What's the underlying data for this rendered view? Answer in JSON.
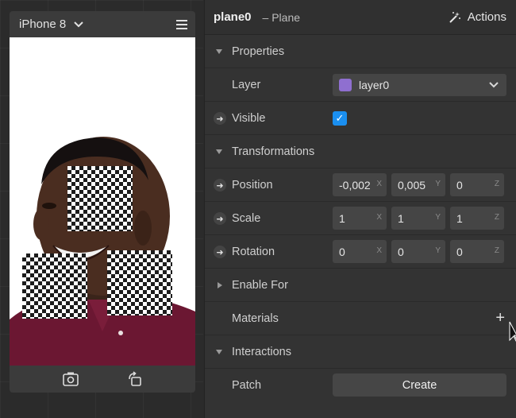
{
  "device": {
    "name": "iPhone 8",
    "chevron_icon": "chevron-down-icon",
    "menu_icon": "hamburger-menu-icon",
    "bottom_icons": [
      "flip-camera-icon",
      "rotate-device-icon"
    ]
  },
  "inspector": {
    "object_name": "plane0",
    "object_type": "– Plane",
    "actions_label": "Actions",
    "actions_icon": "magic-wand-icon"
  },
  "properties": {
    "header": "Properties",
    "layer_label": "Layer",
    "layer_value": "layer0",
    "layer_color": "#8f6fd0",
    "visible_label": "Visible",
    "visible_checked": true
  },
  "transformations": {
    "header": "Transformations",
    "position": {
      "label": "Position",
      "x": "-0,002",
      "y": "0,005",
      "z": "0"
    },
    "scale": {
      "label": "Scale",
      "x": "1",
      "y": "1",
      "z": "1"
    },
    "rotation": {
      "label": "Rotation",
      "x": "0",
      "y": "0",
      "z": "0"
    },
    "axes": {
      "x": "X",
      "y": "Y",
      "z": "Z"
    }
  },
  "enable_for": {
    "header": "Enable For"
  },
  "materials": {
    "label": "Materials",
    "add_symbol": "+"
  },
  "interactions": {
    "header": "Interactions",
    "patch_label": "Patch",
    "create_label": "Create"
  },
  "colors": {
    "accent": "#1a8ff0",
    "panel": "#333333",
    "field": "#454545"
  }
}
